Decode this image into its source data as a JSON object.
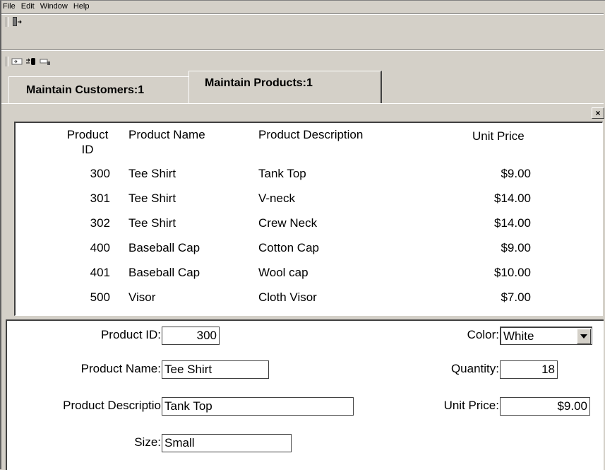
{
  "menu": {
    "items": [
      "File",
      "Edit",
      "Window",
      "Help"
    ]
  },
  "toolbar1": {
    "icons": [
      "exit-icon"
    ]
  },
  "toolbar2": {
    "icons": [
      "form-icon",
      "connect-icon",
      "disconnect-icon"
    ]
  },
  "tabs": [
    {
      "label": "Maintain Customers:1",
      "active": false
    },
    {
      "label": "Maintain Products:1",
      "active": true
    }
  ],
  "close_label": "×",
  "grid": {
    "columns": {
      "id_line1": "Product",
      "id_line2": "ID",
      "name": "Product Name",
      "description": "Product Description",
      "price": "Unit Price"
    },
    "rows": [
      {
        "id": "300",
        "name": "Tee Shirt",
        "description": "Tank Top",
        "price": "$9.00"
      },
      {
        "id": "301",
        "name": "Tee Shirt",
        "description": "V-neck",
        "price": "$14.00"
      },
      {
        "id": "302",
        "name": "Tee Shirt",
        "description": "Crew Neck",
        "price": "$14.00"
      },
      {
        "id": "400",
        "name": "Baseball Cap",
        "description": "Cotton Cap",
        "price": "$9.00"
      },
      {
        "id": "401",
        "name": "Baseball Cap",
        "description": "Wool cap",
        "price": "$10.00"
      },
      {
        "id": "500",
        "name": "Visor",
        "description": "Cloth Visor",
        "price": "$7.00"
      }
    ]
  },
  "form": {
    "product_id_label": "Product ID:",
    "product_id_value": "300",
    "product_name_label": "Product Name:",
    "product_name_value": "Tee Shirt",
    "product_description_label": "Product Descriptio",
    "product_description_value": "Tank Top",
    "size_label": "Size:",
    "size_value": "Small",
    "color_label": "Color:",
    "color_value": "White",
    "quantity_label": "Quantity:",
    "quantity_value": "18",
    "unit_price_label": "Unit Price:",
    "unit_price_value": "$9.00"
  }
}
